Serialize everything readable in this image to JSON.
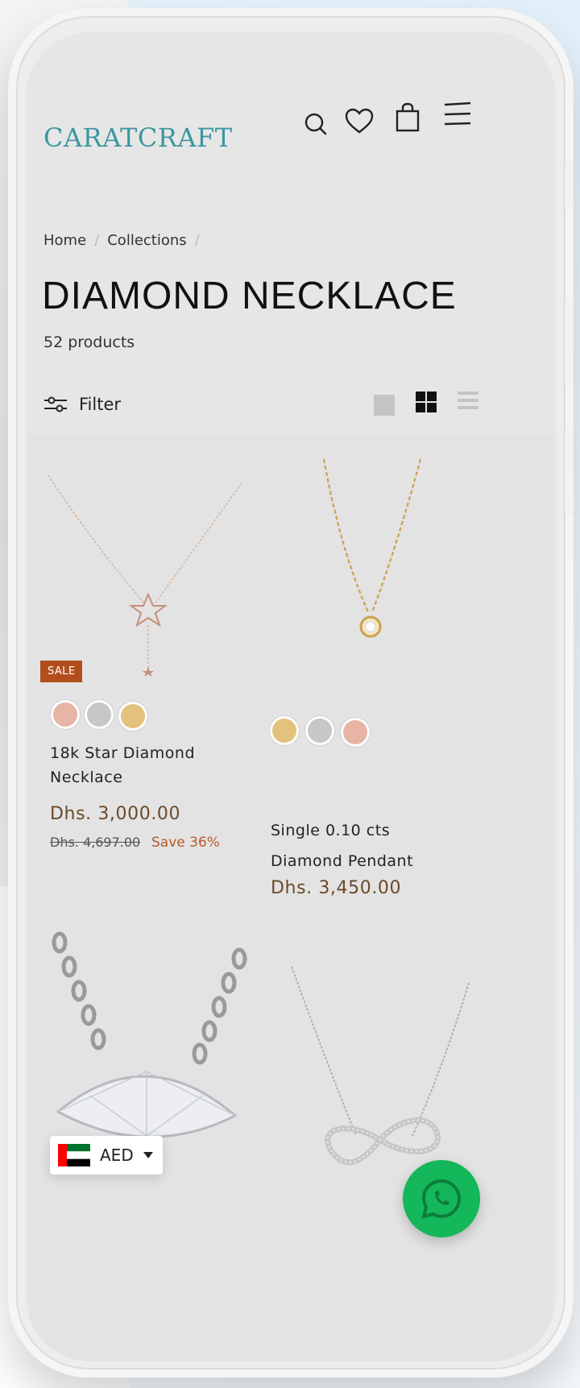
{
  "header": {
    "logo": "CARATCRAFT",
    "icons": [
      "search-icon",
      "heart-icon",
      "bag-icon",
      "menu-icon"
    ]
  },
  "breadcrumb": {
    "home": "Home",
    "collections": "Collections",
    "separator": "/"
  },
  "page": {
    "title": "DIAMOND NECKLACE",
    "count": "52 products"
  },
  "toolbar": {
    "filter_label": "Filter",
    "views": [
      "grid-large",
      "grid-2",
      "list"
    ]
  },
  "products": [
    {
      "title_line1": "18k Star Diamond",
      "title_line2": "Necklace",
      "price": "Dhs. 3,000.00",
      "compare_price": "Dhs. 4,697.00",
      "save": "Save 36%",
      "badge": "SALE",
      "swatches": [
        "#e7b4a6",
        "#c7c7c7",
        "#e2c27c"
      ]
    },
    {
      "title_line1": "Single 0.10 cts",
      "title_line2": "Diamond Pendant",
      "price": "Dhs. 3,450.00",
      "swatches": [
        "#e2c27c",
        "#c7c7c7",
        "#e7b4a6"
      ]
    },
    {
      "image": "marquise-diamond-necklace"
    },
    {
      "image": "infinity-mom-necklace"
    }
  ],
  "currency": {
    "code": "AED",
    "flag": "uae-flag"
  },
  "colors": {
    "brand": "#3d96a1",
    "sale": "#b34e1c",
    "price": "#6b4a2a",
    "whatsapp": "#14b85a"
  }
}
